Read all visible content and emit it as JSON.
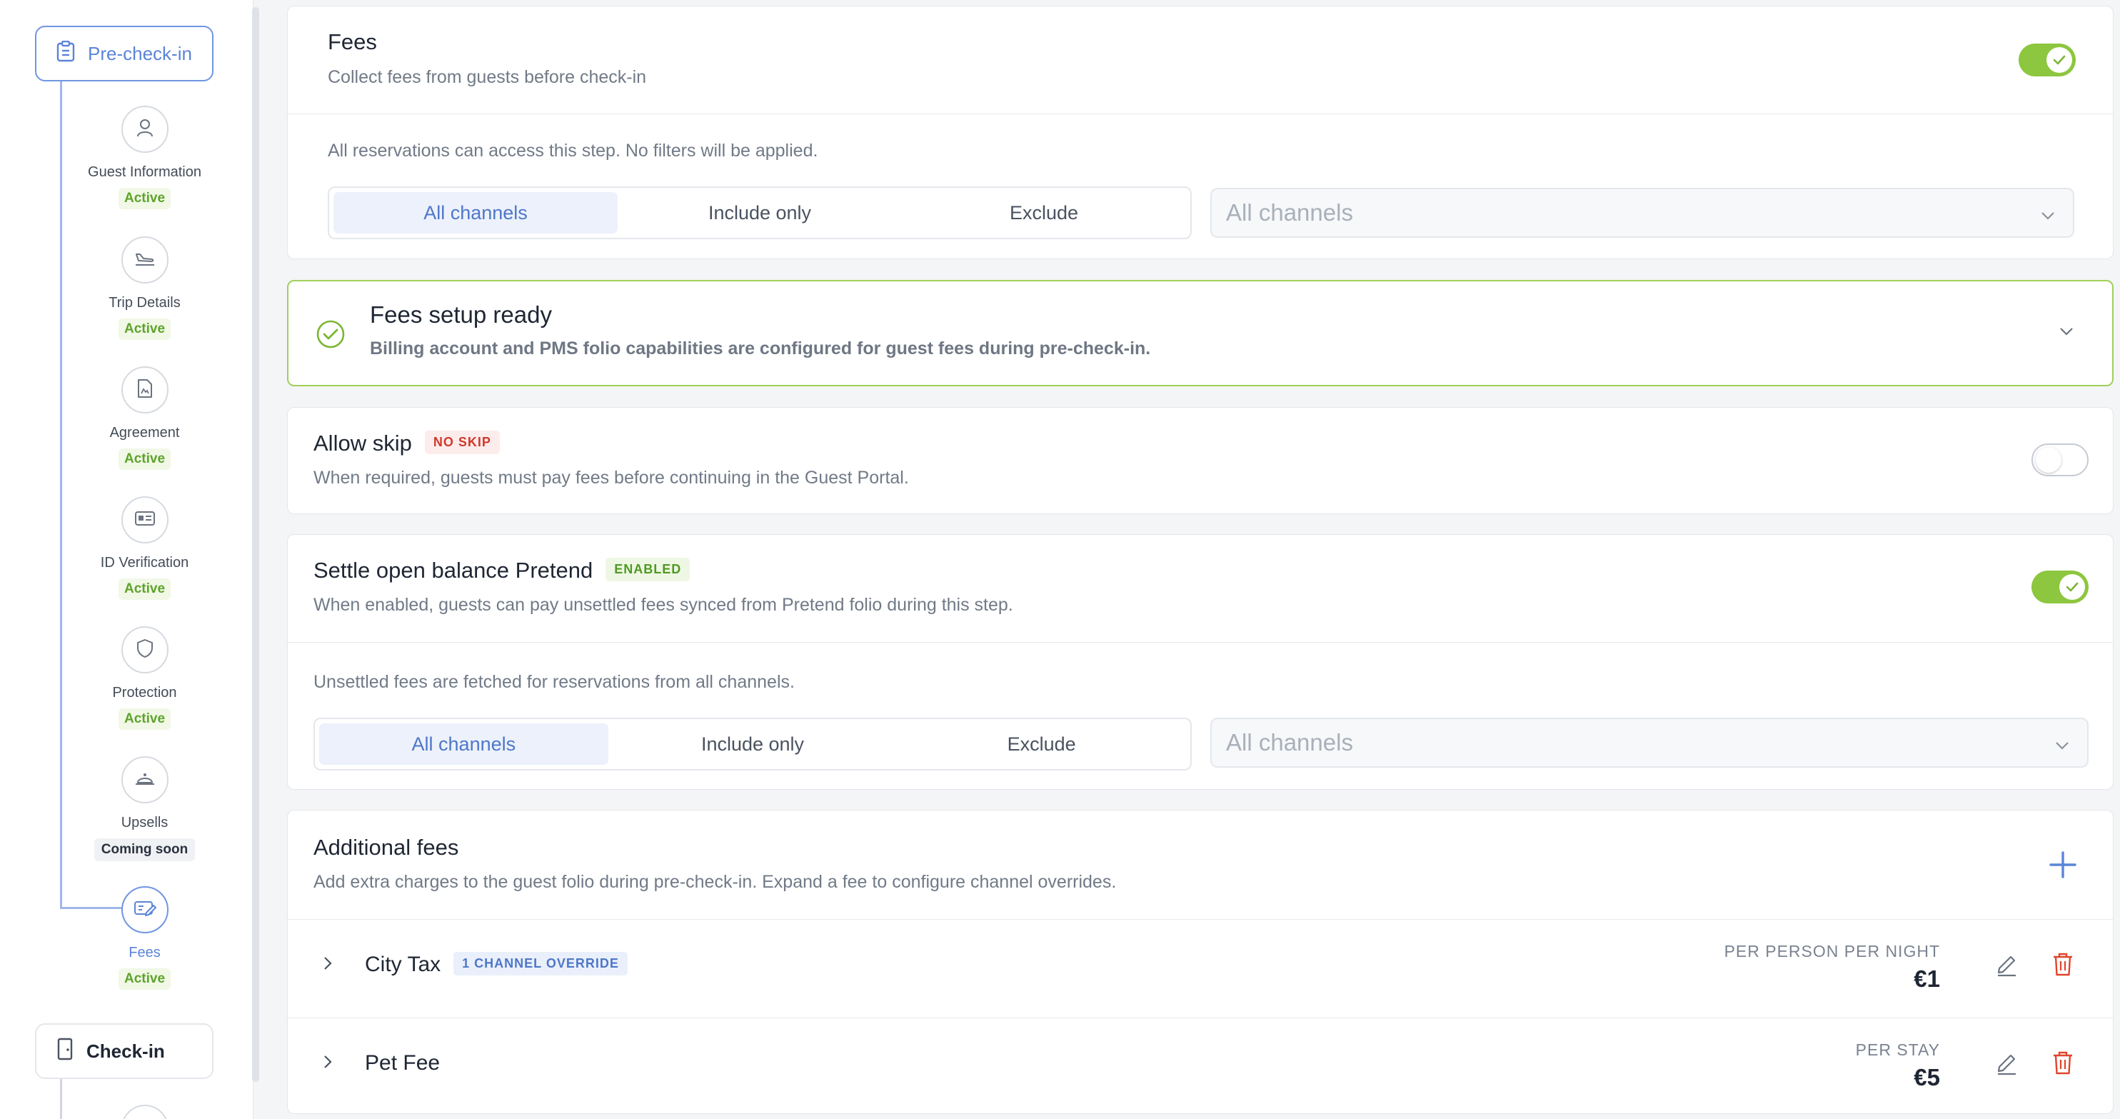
{
  "sidebar": {
    "precheckin_label": "Pre-check-in",
    "checkin_label": "Check-in",
    "steps": [
      {
        "name": "Guest Information",
        "status": "Active",
        "icon": "person-icon"
      },
      {
        "name": "Trip Details",
        "status": "Active",
        "icon": "plane-landing-icon"
      },
      {
        "name": "Agreement",
        "status": "Active",
        "icon": "document-icon"
      },
      {
        "name": "ID Verification",
        "status": "Active",
        "icon": "id-card-icon"
      },
      {
        "name": "Protection",
        "status": "Active",
        "icon": "shield-icon"
      },
      {
        "name": "Upsells",
        "status": "Coming soon",
        "icon": "bell-icon"
      },
      {
        "name": "Fees",
        "status": "Active",
        "icon": "receipt-icon"
      }
    ]
  },
  "fees_card": {
    "title": "Fees",
    "subtitle": "Collect fees from guests before check-in",
    "enabled": true,
    "filter_note": "All reservations can access this step. No filters will be applied.",
    "segments": [
      "All channels",
      "Include only",
      "Exclude"
    ],
    "selected_segment": "All channels",
    "dropdown_placeholder": "All channels"
  },
  "setup_card": {
    "title": "Fees setup ready",
    "subtitle": "Billing account and PMS folio capabilities are configured for guest fees during pre-check-in."
  },
  "allow_skip": {
    "title": "Allow skip",
    "badge": "NO SKIP",
    "subtitle": "When required, guests must pay fees before continuing in the Guest Portal.",
    "enabled": false
  },
  "settle": {
    "title": "Settle open balance Pretend",
    "badge": "ENABLED",
    "subtitle": "When enabled, guests can pay unsettled fees synced from Pretend folio during this step.",
    "enabled": true,
    "note": "Unsettled fees are fetched for reservations from all channels.",
    "segments": [
      "All channels",
      "Include only",
      "Exclude"
    ],
    "selected_segment": "All channels",
    "dropdown_placeholder": "All channels"
  },
  "additional_fees": {
    "title": "Additional fees",
    "subtitle": "Add extra charges to the guest folio during pre-check-in. Expand a fee to configure channel overrides.",
    "items": [
      {
        "name": "City Tax",
        "badge": "1 CHANNEL OVERRIDE",
        "unit": "PER PERSON PER NIGHT",
        "amount": "€1"
      },
      {
        "name": "Pet Fee",
        "badge": "",
        "unit": "PER STAY",
        "amount": "€5"
      }
    ]
  },
  "colors": {
    "accent": "#5b84d8",
    "success": "#8dc63f",
    "danger": "#e0452d"
  }
}
